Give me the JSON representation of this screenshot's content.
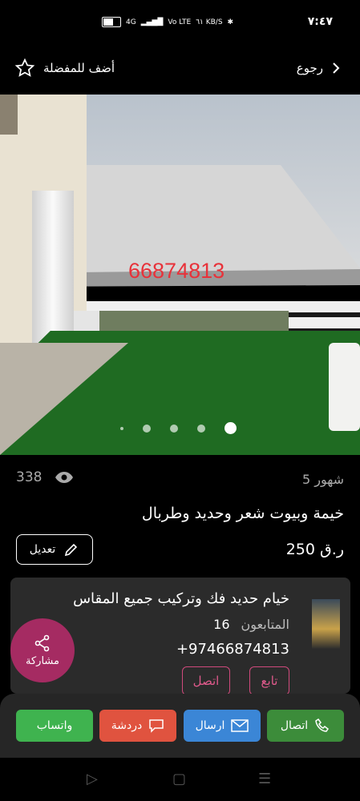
{
  "status_bar": {
    "time": "٧:٤٧",
    "network": "4G",
    "speed": "٦١ KB/S",
    "volte": "Vo LTE"
  },
  "nav": {
    "favorite_label": "أضف للمفضلة",
    "back_label": "رجوع"
  },
  "photo": {
    "watermark": "66874813",
    "slide_count": 5,
    "active_slide": 5
  },
  "listing": {
    "views": "338",
    "age": "5 شهور",
    "title": "خيمة وبيوت شعر وحديد وطربال",
    "price": "250 ر.ق",
    "edit_label": "تعديل"
  },
  "seller": {
    "name": "خيام حديد فك وتركيب جميع المقاس",
    "followers_label": "المتابعون",
    "followers_count": "16",
    "phone": "+97466874813",
    "follow_label": "تابع",
    "call_label": "اتصل"
  },
  "share_label": "مشاركة",
  "actions": {
    "call": {
      "label": "اتصال",
      "color": "#3c8c3a"
    },
    "send": {
      "label": "ارسال",
      "color": "#3b86d6"
    },
    "chat": {
      "label": "دردشة",
      "color": "#e0533f"
    },
    "whatsapp": {
      "label": "واتساب",
      "color": "#3fb34f"
    }
  },
  "accent_color": "#a52b62"
}
